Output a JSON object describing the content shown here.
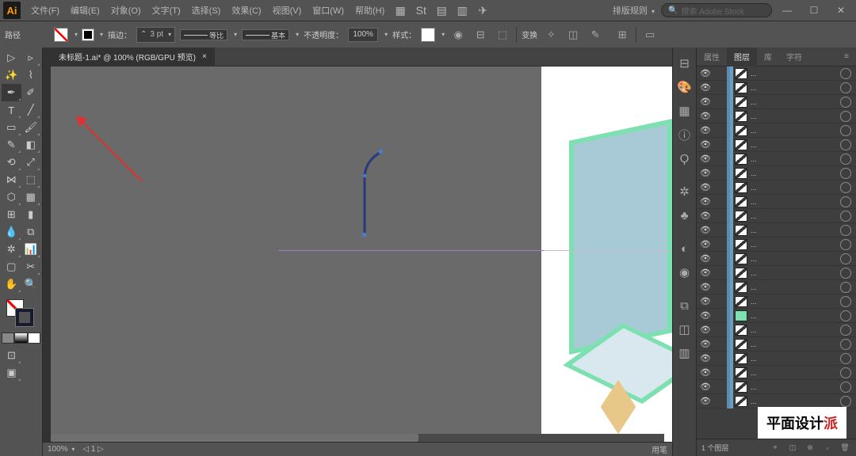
{
  "menu": {
    "items": [
      "文件(F)",
      "编辑(E)",
      "对象(O)",
      "文字(T)",
      "选择(S)",
      "效果(C)",
      "视图(V)",
      "窗口(W)",
      "帮助(H)"
    ],
    "layout_label": "排版规则",
    "search_placeholder": "搜索 Adobe Stock"
  },
  "control": {
    "path_label": "路径",
    "stroke_label": "描边：",
    "stroke_weight": "3 pt",
    "profile_uniform": "等比",
    "profile_basic": "基本",
    "opacity_label": "不透明度：",
    "opacity_value": "100%",
    "style_label": "样式：",
    "transform_label": "变换"
  },
  "tab": {
    "title": "未标题-1.ai* @ 100% (RGB/GPU 预览)"
  },
  "status": {
    "zoom": "100%",
    "info": "用笔"
  },
  "panel": {
    "tabs": [
      "属性",
      "图层",
      "库",
      "字符"
    ],
    "active": 1,
    "footer_count": "1 个图层"
  },
  "layers": [
    {
      "name": "...",
      "thumb": "diag"
    },
    {
      "name": "...",
      "thumb": "diag"
    },
    {
      "name": "...",
      "thumb": "diag"
    },
    {
      "name": "...",
      "thumb": "diag"
    },
    {
      "name": "...",
      "thumb": "diag"
    },
    {
      "name": "...",
      "thumb": "diag"
    },
    {
      "name": "...",
      "thumb": "diag"
    },
    {
      "name": "...",
      "thumb": "diag"
    },
    {
      "name": "...",
      "thumb": "diag"
    },
    {
      "name": "...",
      "thumb": "diag"
    },
    {
      "name": "...",
      "thumb": "diag"
    },
    {
      "name": "...",
      "thumb": "diag"
    },
    {
      "name": "...",
      "thumb": "diag"
    },
    {
      "name": "...",
      "thumb": "diag"
    },
    {
      "name": "...",
      "thumb": "diag"
    },
    {
      "name": "...",
      "thumb": "diag"
    },
    {
      "name": "...",
      "thumb": "diag"
    },
    {
      "name": "...",
      "thumb": "teal"
    },
    {
      "name": "...",
      "thumb": "diag"
    },
    {
      "name": "...",
      "thumb": "diag"
    },
    {
      "name": "...",
      "thumb": "diag"
    },
    {
      "name": "...",
      "thumb": "diag"
    },
    {
      "name": "...",
      "thumb": "diag"
    },
    {
      "name": "...",
      "thumb": "diag"
    }
  ],
  "watermark": {
    "text_black": "平面设计",
    "text_red": "派"
  }
}
